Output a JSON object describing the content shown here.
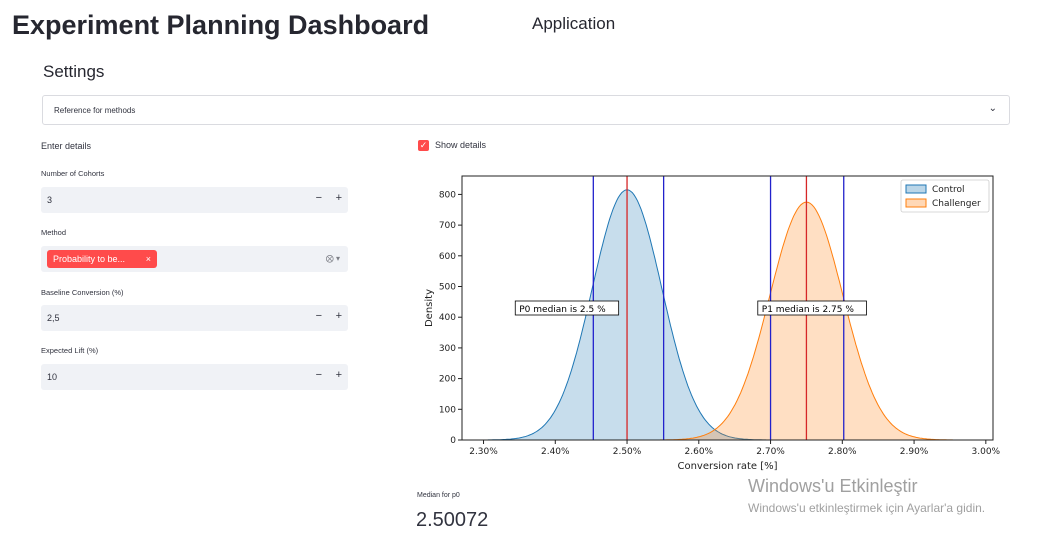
{
  "header": {
    "title": "Experiment Planning Dashboard",
    "app_label": "Application",
    "settings_title": "Settings"
  },
  "expander": {
    "label": "Reference for methods",
    "icon": "chevron-down-icon"
  },
  "form": {
    "heading": "Enter details",
    "cohorts": {
      "label": "Number of Cohorts",
      "value": "3"
    },
    "method": {
      "label": "Method",
      "selected": "Probability to be...",
      "remove": "×"
    },
    "baseline": {
      "label": "Baseline Conversion (%)",
      "value": "2,5"
    },
    "lift": {
      "label": "Expected Lift (%)",
      "value": "10"
    },
    "minus": "−",
    "plus": "+"
  },
  "checkbox": {
    "label": "Show details",
    "checked": true,
    "check_glyph": "✓"
  },
  "metric": {
    "label": "Median for p0",
    "value": "2.50072"
  },
  "watermark": {
    "title": "Windows'u Etkinleştir",
    "subtitle": "Windows'u etkinleştirmek için Ayarlar'a gidin."
  },
  "colors": {
    "accent": "#ff4b4b",
    "control": "#1f77b4",
    "challenger": "#ff7f0e"
  },
  "chart_data": {
    "type": "area",
    "xlabel": "Conversion rate [%]",
    "ylabel": "Density",
    "xlim": [
      2.27,
      3.01
    ],
    "ylim": [
      0,
      860
    ],
    "xticks": [
      2.3,
      2.4,
      2.5,
      2.6,
      2.7,
      2.8,
      2.9,
      3.0
    ],
    "xtick_labels": [
      "2.30%",
      "2.40%",
      "2.50%",
      "2.60%",
      "2.70%",
      "2.80%",
      "2.90%",
      "3.00%"
    ],
    "yticks": [
      0,
      100,
      200,
      300,
      400,
      500,
      600,
      700,
      800
    ],
    "legend_position": "top-right",
    "series": [
      {
        "name": "Control",
        "color": "#1f77b4",
        "mean": 2.5,
        "sd": 0.0485,
        "peak": 815,
        "median": 2.5,
        "interval": [
          2.453,
          2.551
        ],
        "annotation": "P0 median is 2.5 %",
        "annotation_at": [
          2.347,
          430
        ]
      },
      {
        "name": "Challenger",
        "color": "#ff7f0e",
        "mean": 2.75,
        "sd": 0.051,
        "peak": 775,
        "median": 2.75,
        "interval": [
          2.7,
          2.802
        ],
        "annotation": "P1 median is 2.75 %",
        "annotation_at": [
          2.685,
          430
        ]
      }
    ]
  }
}
